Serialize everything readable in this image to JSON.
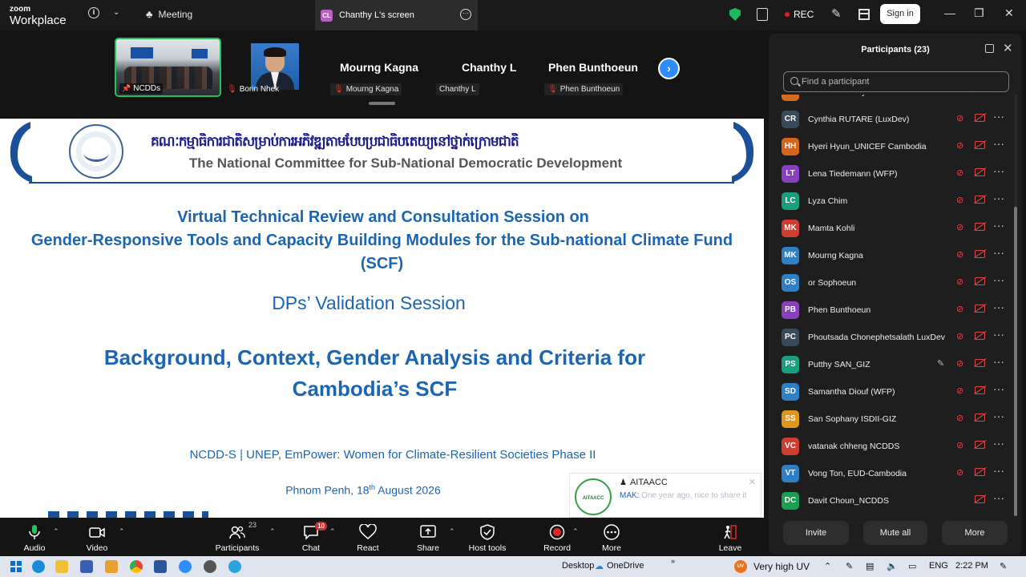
{
  "app": {
    "brand_line1": "zoom",
    "brand_line2": "Workplace"
  },
  "titlebar": {
    "meeting_label": "Meeting",
    "tab_badge": "CL",
    "tab_title": "Chanthy L's screen",
    "rec_label": "REC",
    "signin_label": "Sign in"
  },
  "strip": {
    "tiles": [
      {
        "label": "NCDDs"
      },
      {
        "label": "Borin Nhek"
      }
    ],
    "names": [
      {
        "big": "Mourng Kagna",
        "sub": "Mourng Kagna",
        "muted": true
      },
      {
        "big": "Chanthy L",
        "sub": "Chanthy L",
        "muted": false
      },
      {
        "big": "Phen Bunthoeun",
        "sub": "Phen Bunthoeun",
        "muted": true
      }
    ]
  },
  "slide": {
    "khmer_title": "គណៈកម្មាធិការជាតិសម្រាប់ការអភិវឌ្ឍតាមបែបប្រជាធិបតេយ្យនៅថ្នាក់ក្រោមជាតិ",
    "committee": "The National Committee for Sub-National Democratic Development",
    "line1": "Virtual Technical Review and Consultation Session on",
    "line2": "Gender-Responsive Tools and Capacity Building Modules for the Sub-national Climate Fund",
    "line3": "(SCF)",
    "dps": "DPs’ Validation Session",
    "bg1": "Background, Context, Gender Analysis and Criteria for",
    "bg2": "Cambodia’s SCF",
    "ncdd": "NCDD-S | UNEP, EmPower: Women for Climate-Resilient Societies Phase II",
    "date_pre": "Phnom Penh, 18",
    "date_sup": "th",
    "date_post": " August 2026"
  },
  "toast": {
    "logo_text": "AITAACC",
    "title": "AITAACC",
    "sender": "MAK:",
    "message": "One year ago, nice to share it"
  },
  "panel": {
    "title": "Participants (23)",
    "search_placeholder": "Find a participant",
    "participants": [
      {
        "initials": "CS",
        "name": "Chhorn Somaly NCDD",
        "color": "#d66a1e",
        "pen": false,
        "mic_muted": true
      },
      {
        "initials": "CR",
        "name": "Cynthia RUTARE (LuxDev)",
        "color": "#3a4a5c",
        "pen": false,
        "mic_muted": true
      },
      {
        "initials": "HH",
        "name": "Hyeri Hyun_UNICEF Cambodia",
        "color": "#d6651c",
        "pen": false,
        "mic_muted": true
      },
      {
        "initials": "LT",
        "name": "Lena Tiedemann (WFP)",
        "color": "#8a3fc0",
        "pen": false,
        "mic_muted": true
      },
      {
        "initials": "LC",
        "name": "Lyza Chim",
        "color": "#1a9e80",
        "pen": false,
        "mic_muted": true
      },
      {
        "initials": "MK",
        "name": "Mamta Kohli",
        "color": "#cf3d32",
        "pen": false,
        "mic_muted": true
      },
      {
        "initials": "MK",
        "name": "Mourng Kagna",
        "color": "#2f7fc7",
        "pen": false,
        "mic_muted": true
      },
      {
        "initials": "OS",
        "name": "or Sophoeun",
        "color": "#2f7fc7",
        "pen": false,
        "mic_muted": true
      },
      {
        "initials": "PB",
        "name": "Phen Bunthoeun",
        "color": "#8a3fc0",
        "pen": false,
        "mic_muted": true
      },
      {
        "initials": "PC",
        "name": "Phoutsada Chonephetsalath LuxDev",
        "color": "#3a4a5c",
        "pen": false,
        "mic_muted": true
      },
      {
        "initials": "PS",
        "name": "Putthy SAN_GIZ",
        "color": "#1a9e80",
        "pen": true,
        "mic_muted": true
      },
      {
        "initials": "SD",
        "name": "Samantha Diouf (WFP)",
        "color": "#2f7fc7",
        "pen": false,
        "mic_muted": true
      },
      {
        "initials": "SS",
        "name": "San Sophany ISDII-GIZ",
        "color": "#e0961c",
        "pen": false,
        "mic_muted": true
      },
      {
        "initials": "VC",
        "name": "vatanak chheng NCDDS",
        "color": "#cf3d32",
        "pen": false,
        "mic_muted": true
      },
      {
        "initials": "VT",
        "name": "Vong Ton, EUD-Cambodia",
        "color": "#2f7fc7",
        "pen": false,
        "mic_muted": true
      },
      {
        "initials": "DC",
        "name": "Davit Choun_NCDDS",
        "color": "#1a9e50",
        "pen": false,
        "mic_muted": false
      }
    ],
    "buttons": {
      "invite": "Invite",
      "mute_all": "Mute all",
      "more": "More"
    }
  },
  "toolbar": {
    "audio": "Audio",
    "video": "Video",
    "participants": "Participants",
    "participants_count": "23",
    "chat": "Chat",
    "chat_badge": "10",
    "react": "React",
    "share": "Share",
    "host_tools": "Host tools",
    "record": "Record",
    "more": "More",
    "leave": "Leave"
  },
  "taskbar": {
    "desktop": "Desktop",
    "onedrive": "OneDrive",
    "weather_badge": "UV",
    "weather": "Very high UV",
    "lang": "ENG",
    "time": "2:22 PM"
  }
}
